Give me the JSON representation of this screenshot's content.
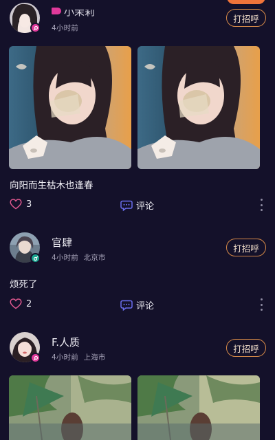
{
  "posts": [
    {
      "username": "小茉莉",
      "time": "4小时前",
      "location": "",
      "greet_label": "打招呼",
      "text": "向阳而生枯木也逢春",
      "likes": "3",
      "comment_label": "评论",
      "gender": "female"
    },
    {
      "username": "官肆",
      "time": "4小时前",
      "location": "北京市",
      "greet_label": "打招呼",
      "text": "烦死了",
      "likes": "2",
      "comment_label": "评论",
      "gender": "male"
    },
    {
      "username": "F.人质",
      "time": "4小时前",
      "location": "上海市",
      "greet_label": "打招呼",
      "text": "",
      "likes": "",
      "comment_label": "",
      "gender": "female"
    }
  ],
  "icons": {
    "like": "heart-outline-icon",
    "comment": "chat-bubble-icon",
    "more": "more-vertical-icon",
    "female": "female-gender-icon",
    "male": "male-gender-icon"
  },
  "colors": {
    "background": "#14112a",
    "accent_like": "#e0588f",
    "accent_comment": "#6b6ff0",
    "greet_border": "#d78a48",
    "female_badge": "#e0399a",
    "male_badge": "#19a48e"
  }
}
